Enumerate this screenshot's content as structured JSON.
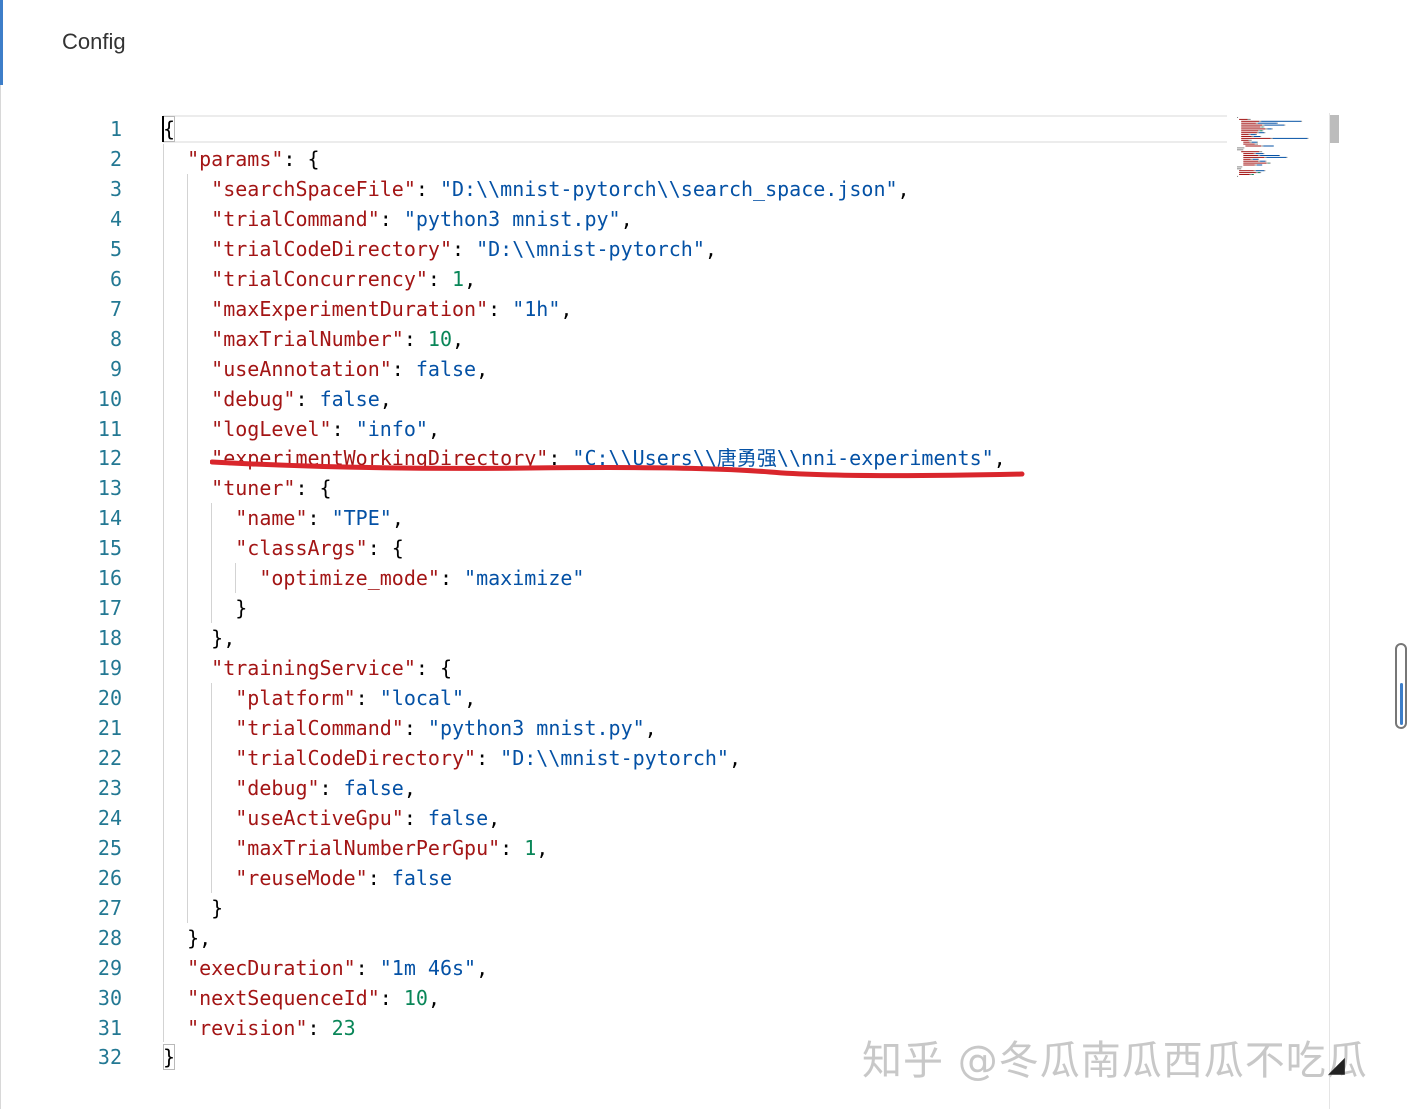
{
  "title": "Config",
  "lines": [
    [
      {
        "t": "p",
        "v": "{"
      }
    ],
    [
      {
        "t": "p",
        "v": "  "
      },
      {
        "t": "k",
        "v": "\"params\""
      },
      {
        "t": "p",
        "v": ": {"
      }
    ],
    [
      {
        "t": "p",
        "v": "    "
      },
      {
        "t": "k",
        "v": "\"searchSpaceFile\""
      },
      {
        "t": "p",
        "v": ": "
      },
      {
        "t": "s",
        "v": "\"D:\\\\mnist-pytorch\\\\search_space.json\""
      },
      {
        "t": "p",
        "v": ","
      }
    ],
    [
      {
        "t": "p",
        "v": "    "
      },
      {
        "t": "k",
        "v": "\"trialCommand\""
      },
      {
        "t": "p",
        "v": ": "
      },
      {
        "t": "s",
        "v": "\"python3 mnist.py\""
      },
      {
        "t": "p",
        "v": ","
      }
    ],
    [
      {
        "t": "p",
        "v": "    "
      },
      {
        "t": "k",
        "v": "\"trialCodeDirectory\""
      },
      {
        "t": "p",
        "v": ": "
      },
      {
        "t": "s",
        "v": "\"D:\\\\mnist-pytorch\""
      },
      {
        "t": "p",
        "v": ","
      }
    ],
    [
      {
        "t": "p",
        "v": "    "
      },
      {
        "t": "k",
        "v": "\"trialConcurrency\""
      },
      {
        "t": "p",
        "v": ": "
      },
      {
        "t": "n",
        "v": "1"
      },
      {
        "t": "p",
        "v": ","
      }
    ],
    [
      {
        "t": "p",
        "v": "    "
      },
      {
        "t": "k",
        "v": "\"maxExperimentDuration\""
      },
      {
        "t": "p",
        "v": ": "
      },
      {
        "t": "s",
        "v": "\"1h\""
      },
      {
        "t": "p",
        "v": ","
      }
    ],
    [
      {
        "t": "p",
        "v": "    "
      },
      {
        "t": "k",
        "v": "\"maxTrialNumber\""
      },
      {
        "t": "p",
        "v": ": "
      },
      {
        "t": "n",
        "v": "10"
      },
      {
        "t": "p",
        "v": ","
      }
    ],
    [
      {
        "t": "p",
        "v": "    "
      },
      {
        "t": "k",
        "v": "\"useAnnotation\""
      },
      {
        "t": "p",
        "v": ": "
      },
      {
        "t": "b",
        "v": "false"
      },
      {
        "t": "p",
        "v": ","
      }
    ],
    [
      {
        "t": "p",
        "v": "    "
      },
      {
        "t": "k",
        "v": "\"debug\""
      },
      {
        "t": "p",
        "v": ": "
      },
      {
        "t": "b",
        "v": "false"
      },
      {
        "t": "p",
        "v": ","
      }
    ],
    [
      {
        "t": "p",
        "v": "    "
      },
      {
        "t": "k",
        "v": "\"logLevel\""
      },
      {
        "t": "p",
        "v": ": "
      },
      {
        "t": "s",
        "v": "\"info\""
      },
      {
        "t": "p",
        "v": ","
      }
    ],
    [
      {
        "t": "p",
        "v": "    "
      },
      {
        "t": "k",
        "v": "\"experimentWorkingDirectory\""
      },
      {
        "t": "p",
        "v": ": "
      },
      {
        "t": "s",
        "v": "\"C:\\\\Users\\\\唐勇强\\\\nni-experiments\""
      },
      {
        "t": "p",
        "v": ","
      }
    ],
    [
      {
        "t": "p",
        "v": "    "
      },
      {
        "t": "k",
        "v": "\"tuner\""
      },
      {
        "t": "p",
        "v": ": {"
      }
    ],
    [
      {
        "t": "p",
        "v": "      "
      },
      {
        "t": "k",
        "v": "\"name\""
      },
      {
        "t": "p",
        "v": ": "
      },
      {
        "t": "s",
        "v": "\"TPE\""
      },
      {
        "t": "p",
        "v": ","
      }
    ],
    [
      {
        "t": "p",
        "v": "      "
      },
      {
        "t": "k",
        "v": "\"classArgs\""
      },
      {
        "t": "p",
        "v": ": {"
      }
    ],
    [
      {
        "t": "p",
        "v": "        "
      },
      {
        "t": "k",
        "v": "\"optimize_mode\""
      },
      {
        "t": "p",
        "v": ": "
      },
      {
        "t": "s",
        "v": "\"maximize\""
      }
    ],
    [
      {
        "t": "p",
        "v": "      }"
      }
    ],
    [
      {
        "t": "p",
        "v": "    },"
      }
    ],
    [
      {
        "t": "p",
        "v": "    "
      },
      {
        "t": "k",
        "v": "\"trainingService\""
      },
      {
        "t": "p",
        "v": ": {"
      }
    ],
    [
      {
        "t": "p",
        "v": "      "
      },
      {
        "t": "k",
        "v": "\"platform\""
      },
      {
        "t": "p",
        "v": ": "
      },
      {
        "t": "s",
        "v": "\"local\""
      },
      {
        "t": "p",
        "v": ","
      }
    ],
    [
      {
        "t": "p",
        "v": "      "
      },
      {
        "t": "k",
        "v": "\"trialCommand\""
      },
      {
        "t": "p",
        "v": ": "
      },
      {
        "t": "s",
        "v": "\"python3 mnist.py\""
      },
      {
        "t": "p",
        "v": ","
      }
    ],
    [
      {
        "t": "p",
        "v": "      "
      },
      {
        "t": "k",
        "v": "\"trialCodeDirectory\""
      },
      {
        "t": "p",
        "v": ": "
      },
      {
        "t": "s",
        "v": "\"D:\\\\mnist-pytorch\""
      },
      {
        "t": "p",
        "v": ","
      }
    ],
    [
      {
        "t": "p",
        "v": "      "
      },
      {
        "t": "k",
        "v": "\"debug\""
      },
      {
        "t": "p",
        "v": ": "
      },
      {
        "t": "b",
        "v": "false"
      },
      {
        "t": "p",
        "v": ","
      }
    ],
    [
      {
        "t": "p",
        "v": "      "
      },
      {
        "t": "k",
        "v": "\"useActiveGpu\""
      },
      {
        "t": "p",
        "v": ": "
      },
      {
        "t": "b",
        "v": "false"
      },
      {
        "t": "p",
        "v": ","
      }
    ],
    [
      {
        "t": "p",
        "v": "      "
      },
      {
        "t": "k",
        "v": "\"maxTrialNumberPerGpu\""
      },
      {
        "t": "p",
        "v": ": "
      },
      {
        "t": "n",
        "v": "1"
      },
      {
        "t": "p",
        "v": ","
      }
    ],
    [
      {
        "t": "p",
        "v": "      "
      },
      {
        "t": "k",
        "v": "\"reuseMode\""
      },
      {
        "t": "p",
        "v": ": "
      },
      {
        "t": "b",
        "v": "false"
      }
    ],
    [
      {
        "t": "p",
        "v": "    }"
      }
    ],
    [
      {
        "t": "p",
        "v": "  },"
      }
    ],
    [
      {
        "t": "p",
        "v": "  "
      },
      {
        "t": "k",
        "v": "\"execDuration\""
      },
      {
        "t": "p",
        "v": ": "
      },
      {
        "t": "s",
        "v": "\"1m 46s\""
      },
      {
        "t": "p",
        "v": ","
      }
    ],
    [
      {
        "t": "p",
        "v": "  "
      },
      {
        "t": "k",
        "v": "\"nextSequenceId\""
      },
      {
        "t": "p",
        "v": ": "
      },
      {
        "t": "n",
        "v": "10"
      },
      {
        "t": "p",
        "v": ","
      }
    ],
    [
      {
        "t": "p",
        "v": "  "
      },
      {
        "t": "k",
        "v": "\"revision\""
      },
      {
        "t": "p",
        "v": ": "
      },
      {
        "t": "n",
        "v": "23"
      }
    ],
    [
      {
        "t": "p",
        "v": "}"
      }
    ]
  ],
  "watermark": "知乎 @冬瓜南瓜西瓜不吃瓜",
  "colors": {
    "key": "#a31515",
    "string": "#0451a5",
    "number": "#098658",
    "line_number": "#237893",
    "annotation": "#d9262c"
  }
}
